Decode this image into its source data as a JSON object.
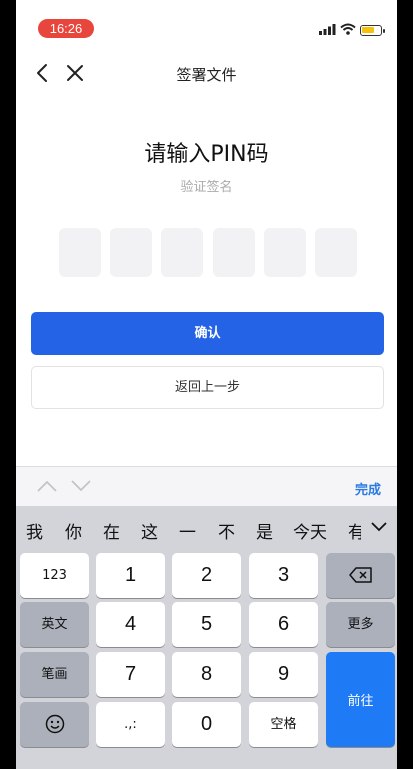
{
  "status": {
    "time": "16:26",
    "battery_level": 0.7,
    "battery_color": "#f4c20d"
  },
  "nav": {
    "title": "签署文件"
  },
  "main": {
    "heading": "请输入PIN码",
    "subheading": "验证签名",
    "pin_length": 6,
    "confirm_label": "确认",
    "back_label": "返回上一步"
  },
  "keyboard": {
    "done_label": "完成",
    "candidates": [
      "我",
      "你",
      "在",
      "这",
      "一",
      "不",
      "是",
      "今天",
      "有"
    ],
    "keys": {
      "k123": "123",
      "k1": "1",
      "k2": "2",
      "k3": "3",
      "english": "英文",
      "k4": "4",
      "k5": "5",
      "k6": "6",
      "more": "更多",
      "stroke": "笔画",
      "k7": "7",
      "k8": "8",
      "k9": "9",
      "go": "前往",
      "punct": ".,:",
      "k0": "0",
      "space": "空格"
    }
  },
  "colors": {
    "accent": "#2563e6",
    "keyboard_bg": "#d2d4da",
    "go_key": "#1e7bf5",
    "time_pill": "#e8453c"
  }
}
